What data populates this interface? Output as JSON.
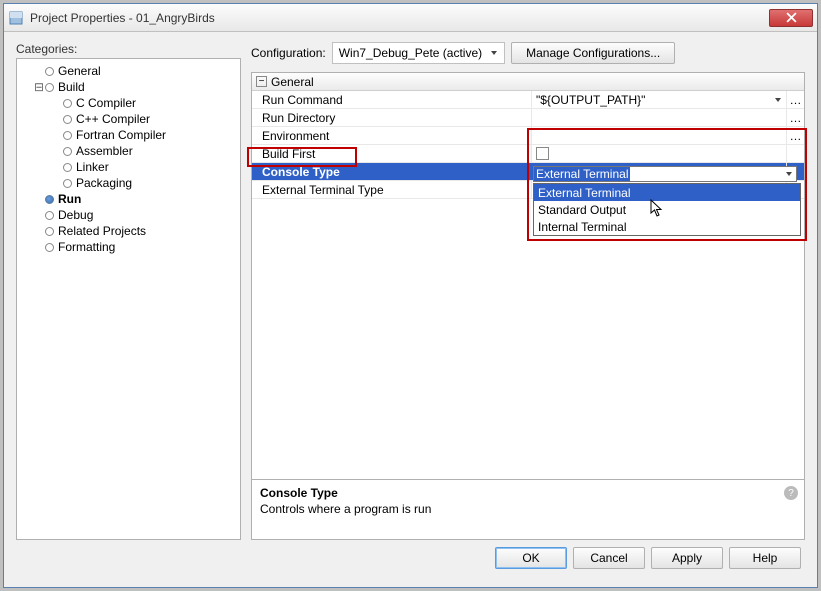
{
  "window": {
    "title": "Project Properties - 01_AngryBirds"
  },
  "categories": {
    "label": "Categories:",
    "items": [
      {
        "label": "General",
        "indent": 1,
        "filled": false
      },
      {
        "label": "Build",
        "indent": 1,
        "filled": false,
        "expandable": true,
        "expanded": true
      },
      {
        "label": "C Compiler",
        "indent": 2,
        "filled": false
      },
      {
        "label": "C++ Compiler",
        "indent": 2,
        "filled": false
      },
      {
        "label": "Fortran Compiler",
        "indent": 2,
        "filled": false
      },
      {
        "label": "Assembler",
        "indent": 2,
        "filled": false
      },
      {
        "label": "Linker",
        "indent": 2,
        "filled": false
      },
      {
        "label": "Packaging",
        "indent": 2,
        "filled": false
      },
      {
        "label": "Run",
        "indent": 1,
        "filled": true,
        "bold": true
      },
      {
        "label": "Debug",
        "indent": 1,
        "filled": false
      },
      {
        "label": "Related Projects",
        "indent": 1,
        "filled": false
      },
      {
        "label": "Formatting",
        "indent": 1,
        "filled": false
      }
    ]
  },
  "config": {
    "label": "Configuration:",
    "selected": "Win7_Debug_Pete (active)",
    "manage_btn": "Manage Configurations..."
  },
  "grid": {
    "group": "General",
    "rows": [
      {
        "key": "Run Command",
        "value": "\"${OUTPUT_PATH}\"",
        "ellipsis": true,
        "caret": true
      },
      {
        "key": "Run Directory",
        "value": "",
        "ellipsis": true
      },
      {
        "key": "Environment",
        "value": "",
        "ellipsis": true
      },
      {
        "key": "Build First",
        "checkbox": true
      },
      {
        "key": "Console Type",
        "value": "External Terminal",
        "selected": true,
        "caret": true
      },
      {
        "key": "External Terminal Type",
        "value": ""
      }
    ]
  },
  "dropdown": {
    "selected_input": "External Terminal",
    "options": [
      "External Terminal",
      "Standard Output",
      "Internal Terminal"
    ],
    "highlighted": 0
  },
  "desc": {
    "title": "Console Type",
    "text": "Controls where a program is run"
  },
  "buttons": {
    "ok": "OK",
    "cancel": "Cancel",
    "apply": "Apply",
    "help": "Help"
  }
}
